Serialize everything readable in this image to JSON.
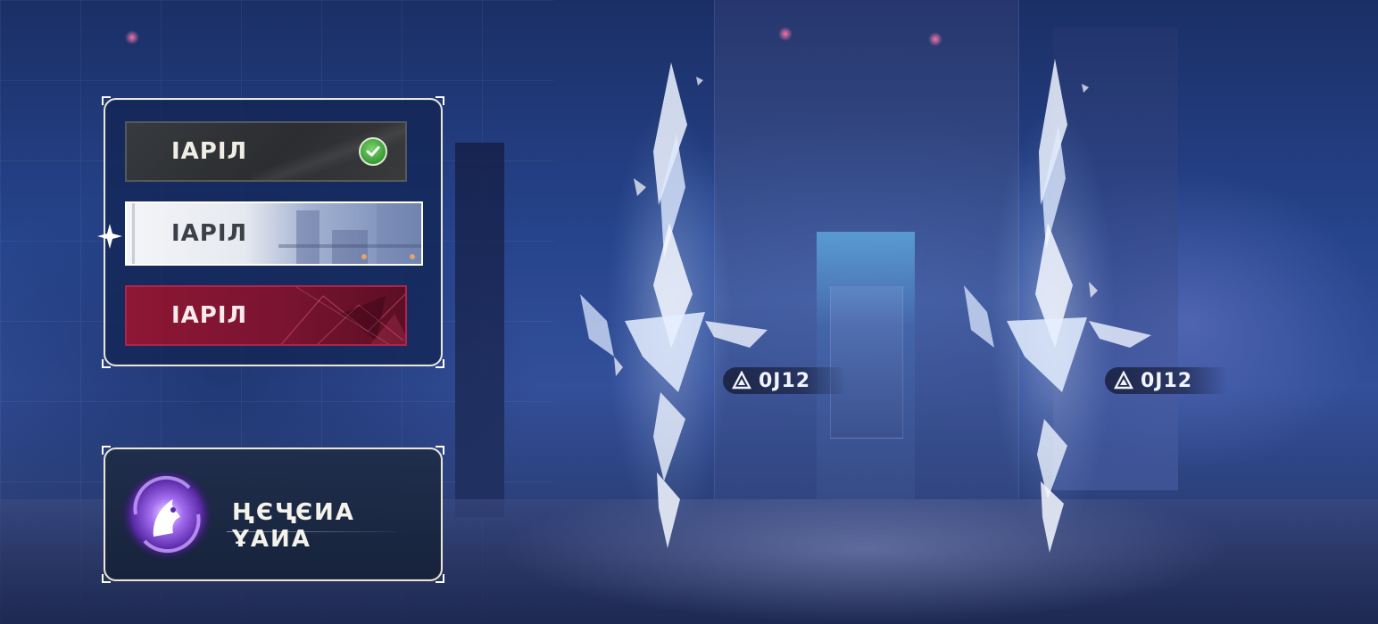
{
  "buttons_panel": {
    "dark_button": {
      "label": "ІАРІЛ",
      "state_icon": "checkmark-circle-icon"
    },
    "light_button": {
      "label": "ІАРІЛ",
      "state_icon": "sparkle-icon"
    },
    "red_button": {
      "label": "ІАРІЛ"
    }
  },
  "title_card": {
    "emblem_icon": "purple-wolf-swirl-emblem",
    "title": "ҢЄҶЄИА ҰАИА"
  },
  "world_tags": [
    {
      "icon": "triangle-glyph-icon",
      "label": "0J12"
    },
    {
      "icon": "triangle-glyph-icon",
      "label": "0J12"
    }
  ],
  "colors": {
    "panel_border": "#eae5d2",
    "dark_button": "#2f3134",
    "light_button": "#eceff5",
    "red_button": "#861633",
    "check_green": "#4caf50",
    "emblem_purple": "#8a4fe0",
    "crystal_glow": "#cfe4ff"
  }
}
